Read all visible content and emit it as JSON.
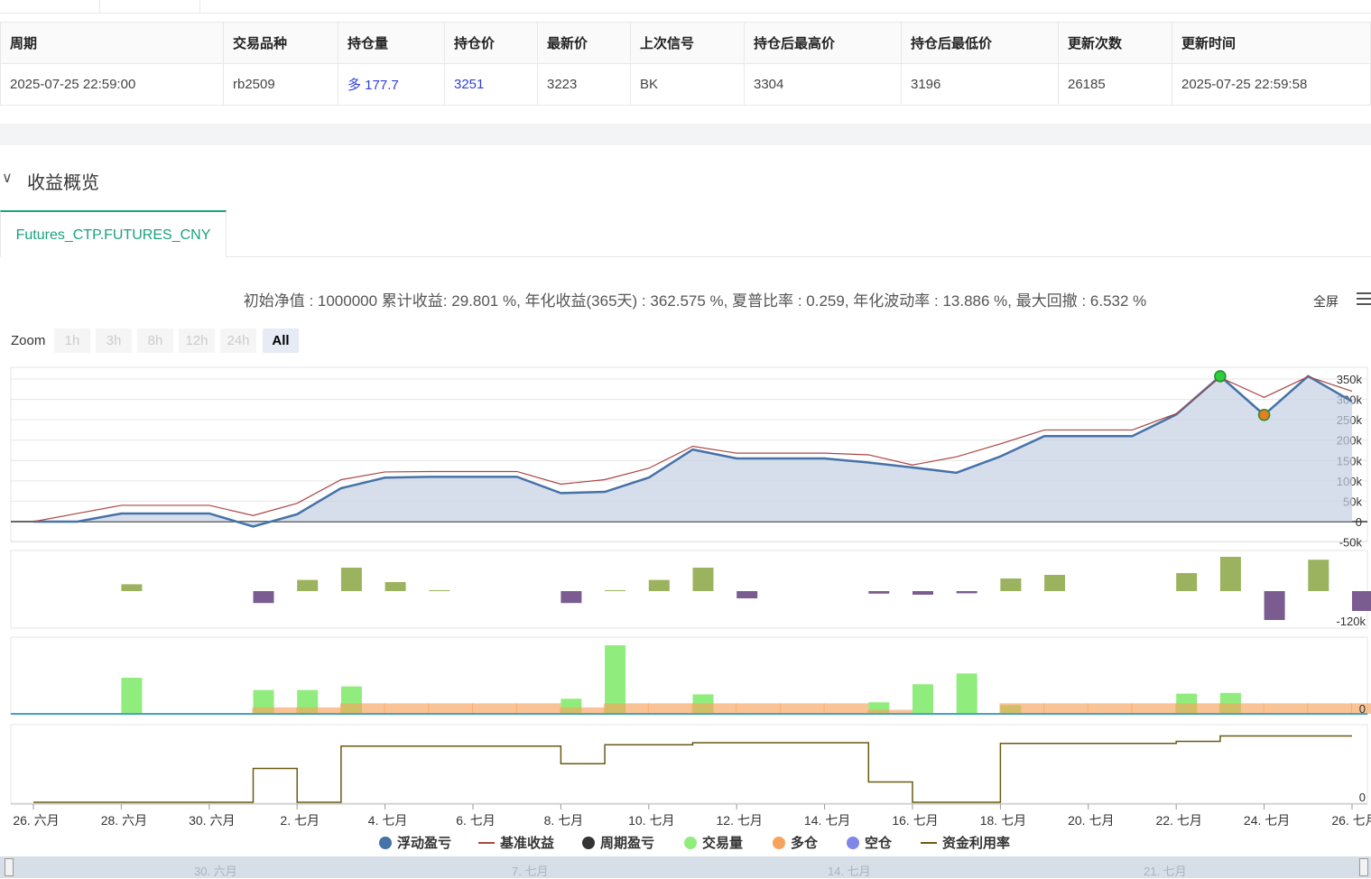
{
  "table": {
    "headers": [
      "周期",
      "交易品种",
      "持仓量",
      "持仓价",
      "最新价",
      "上次信号",
      "持仓后最高价",
      "持仓后最低价",
      "更新次数",
      "更新时间"
    ],
    "row": [
      "2025-07-25 22:59:00",
      "rb2509",
      "多 177.7",
      "3251",
      "3223",
      "BK",
      "3304",
      "3196",
      "26185",
      "2025-07-25 22:59:58"
    ]
  },
  "section": {
    "title": "收益概览"
  },
  "tab": {
    "label": "Futures_CTP.FUTURES_CNY"
  },
  "summary": "初始净值 : 1000000 累计收益: 29.801 %, 年化收益(365天) : 362.575 %, 夏普比率 : 0.259, 年化波动率 : 13.886 %, 最大回撤 : 6.532 %",
  "toolbar": {
    "fullscreen": "全屏"
  },
  "zoom": {
    "label": "Zoom",
    "buttons": [
      "1h",
      "3h",
      "8h",
      "12h",
      "24h",
      "All"
    ],
    "active": "All"
  },
  "colors": {
    "float_pnl": "#4572a7",
    "benchmark": "#aa4643",
    "period_pnl": "#333333",
    "volume": "#90ed7d",
    "long": "#f7a35c",
    "short": "#8085e9",
    "utilization": "#6b5a12",
    "accent": "#1aa17f"
  },
  "chart_data": {
    "type": "line",
    "x_dates": [
      "06-26",
      "06-27",
      "06-28",
      "06-29",
      "06-30",
      "07-01",
      "07-02",
      "07-03",
      "07-04",
      "07-05",
      "07-06",
      "07-07",
      "07-08",
      "07-09",
      "07-10",
      "07-11",
      "07-12",
      "07-13",
      "07-14",
      "07-15",
      "07-16",
      "07-17",
      "07-18",
      "07-19",
      "07-20",
      "07-21",
      "07-22",
      "07-23",
      "07-24",
      "07-25",
      "07-26"
    ],
    "x_tick_labels": [
      "26. 六月",
      "28. 六月",
      "30. 六月",
      "2. 七月",
      "4. 七月",
      "6. 七月",
      "8. 七月",
      "10. 七月",
      "12. 七月",
      "14. 七月",
      "16. 七月",
      "18. 七月",
      "20. 七月",
      "22. 七月",
      "24. 七月",
      "26. 七月"
    ],
    "navigator_labels": [
      "30. 六月",
      "7. 七月",
      "14. 七月",
      "21. 七月"
    ],
    "profit_axis": {
      "ticks": [
        "350k",
        "300k",
        "250k",
        "200k",
        "150k",
        "100k",
        "50k",
        "0",
        "-50k"
      ],
      "range": [
        -50000,
        350000
      ]
    },
    "series": [
      {
        "name": "浮动盈亏",
        "values": [
          0,
          0,
          20000,
          20000,
          20000,
          -12000,
          18000,
          82000,
          108000,
          110000,
          110000,
          110000,
          70000,
          73000,
          108000,
          177000,
          155000,
          155000,
          155000,
          145000,
          133000,
          120000,
          160000,
          210000,
          210000,
          210000,
          263000,
          357000,
          262000,
          357000,
          295000
        ]
      },
      {
        "name": "基准收益",
        "values": [
          0,
          20000,
          40000,
          40000,
          40000,
          15000,
          45000,
          103000,
          122000,
          123000,
          123000,
          123000,
          92000,
          103000,
          131000,
          185000,
          168000,
          168000,
          168000,
          164000,
          139000,
          159000,
          191000,
          225000,
          225000,
          225000,
          265000,
          354000,
          305000,
          356000,
          320000
        ]
      }
    ],
    "period_pnl": {
      "name": "周期盈亏",
      "tick": "-120k",
      "range": [
        -130000,
        100000
      ],
      "values": [
        0,
        0,
        19000,
        0,
        0,
        -33000,
        31000,
        65000,
        25000,
        2000,
        0,
        0,
        -33000,
        2000,
        31000,
        65000,
        -20000,
        0,
        0,
        -7000,
        -10000,
        -6000,
        35000,
        45000,
        0,
        0,
        50000,
        95000,
        -80000,
        87000,
        -55000
      ]
    },
    "volume": {
      "name": "交易量",
      "tick": "0",
      "values": [
        0,
        0,
        50,
        0,
        0,
        33,
        33,
        38,
        0,
        0,
        0,
        0,
        21,
        95,
        0,
        27,
        0,
        0,
        0,
        16,
        41,
        56,
        12,
        0,
        0,
        0,
        28,
        29,
        0,
        0,
        0
      ]
    },
    "long_pos": {
      "name": "多仓",
      "values": [
        0,
        0,
        0,
        0,
        0,
        8,
        8,
        13,
        13,
        13,
        13,
        13,
        8,
        13,
        13,
        13,
        13,
        13,
        13,
        5,
        0,
        0,
        13,
        13,
        13,
        13,
        13,
        13,
        13,
        13,
        13
      ]
    },
    "short_pos": {
      "name": "空仓",
      "values": []
    },
    "utilization": {
      "name": "资金利用率",
      "tick": "0",
      "values": [
        0,
        0,
        0,
        0,
        0,
        50,
        0,
        83,
        83,
        83,
        83,
        83,
        57,
        85,
        85,
        88,
        88,
        88,
        88,
        30,
        0,
        0,
        87,
        87,
        87,
        87,
        90,
        98,
        98,
        98,
        98
      ]
    },
    "trade_markers": [
      {
        "date": "07-23",
        "value": 357000
      },
      {
        "date": "07-24",
        "value": 262000
      }
    ]
  }
}
